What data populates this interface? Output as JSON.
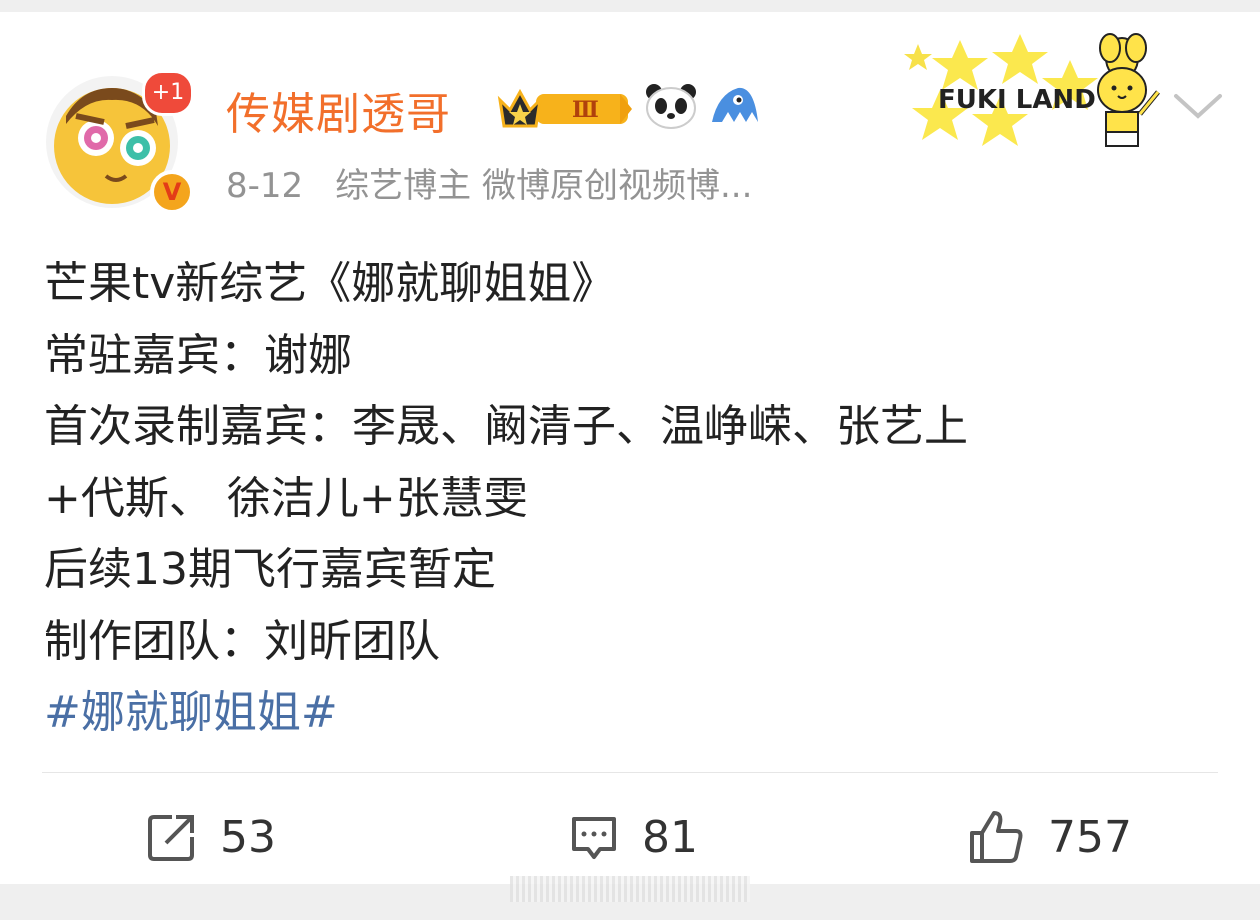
{
  "post": {
    "author": {
      "name": "传媒剧透哥",
      "notification_badge": "+1",
      "verified_mark": "V",
      "level_badge": "Ⅲ"
    },
    "meta": {
      "date": "8-12",
      "description": "综艺博主 微博原创视频博..."
    },
    "sticker_text": "FUKI LAND",
    "content": {
      "lines": [
        "芒果tv新综艺《娜就聊姐姐》",
        "常驻嘉宾：谢娜",
        "首次录制嘉宾：李晟、阚清子、温峥嵘、张艺上",
        "+代斯、 徐洁儿+张慧雯",
        "后续13期飞行嘉宾暂定",
        "制作团队：刘昕团队"
      ],
      "hashtag": "#娜就聊姐姐#"
    },
    "actions": {
      "repost_count": "53",
      "comment_count": "81",
      "like_count": "757"
    }
  },
  "colors": {
    "username": "#f26f2b",
    "hashtag": "#4a6fa5",
    "meta": "#939393",
    "text": "#222222"
  },
  "icons": [
    "crown-badge-icon",
    "panda-icon",
    "shark-icon",
    "chevron-down-icon",
    "repost-icon",
    "comment-icon",
    "like-icon"
  ]
}
